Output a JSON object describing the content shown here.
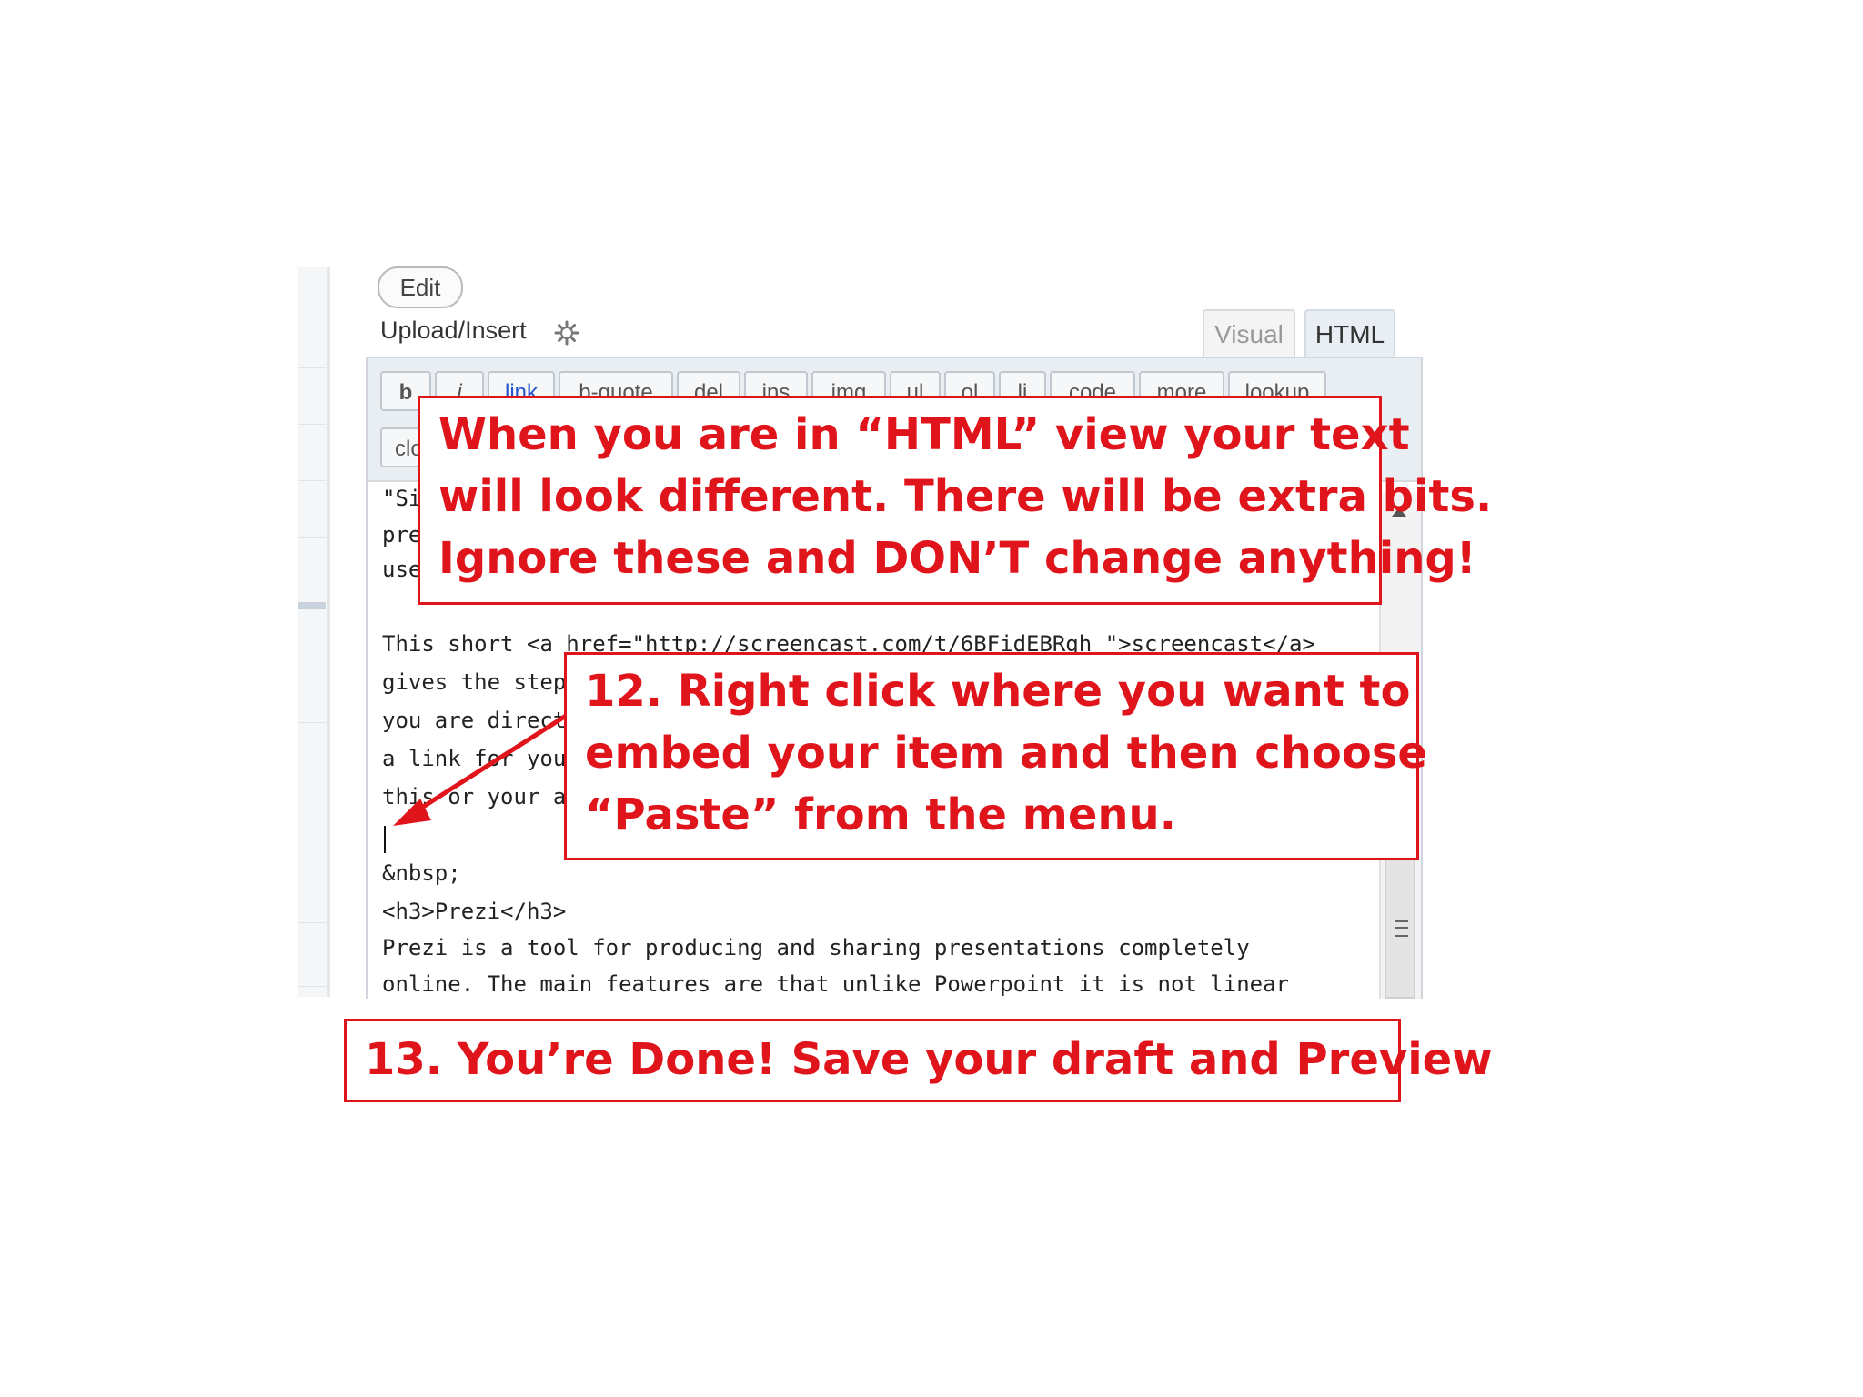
{
  "editor": {
    "edit_button": "Edit",
    "upload_label": "Upload/Insert",
    "tabs": [
      "Visual",
      "HTML"
    ],
    "toolbar": [
      "b",
      "i",
      "link",
      "b-quote",
      "del",
      "ins",
      "img",
      "ul",
      "ol",
      "li",
      "code",
      "more",
      "lookup"
    ],
    "toolbar_row2": [
      "close tags"
    ],
    "code_lines": [
      "\"Si",
      "pre",
      "use",
      "",
      "This short <a href=\"http://screencast.com/t/6BFidEBRgh \">screencast</a>",
      "gives the step",
      "you are direct",
      "a link for you",
      "this or your a",
      "",
      "&nbsp;",
      "<h3>Prezi</h3>",
      "Prezi is a tool for producing and sharing presentations completely",
      "online. The main features are that unlike Powerpoint it is not linear"
    ]
  },
  "callouts": {
    "html_view": [
      "When  you are in “HTML” view your text",
      "will look different. There will be extra bits.",
      "Ignore these and DON’T change anything!"
    ],
    "step12": [
      "12. Right click where you want to",
      "embed your item and then choose",
      "“Paste” from the menu."
    ],
    "step13": "13. You’re Done! Save your draft  and Preview"
  },
  "colors": {
    "callout_red": "#e0141b"
  }
}
